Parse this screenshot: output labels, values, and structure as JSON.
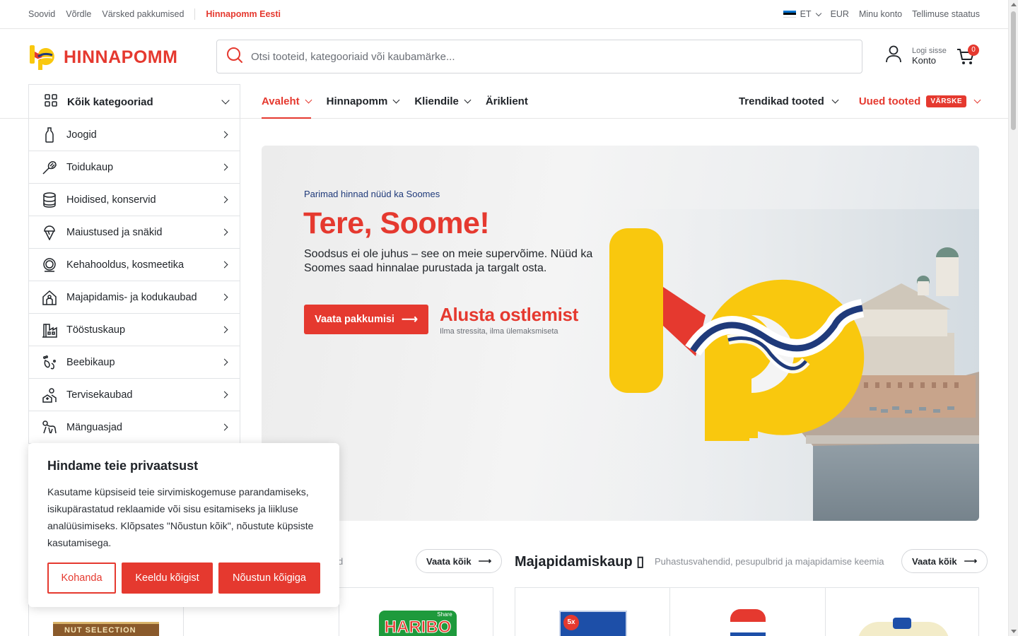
{
  "topbar": {
    "links": [
      "Soovid",
      "Võrdle",
      "Värsked pakkumised"
    ],
    "brand_link": "Hinnapomm Eesti",
    "language": "ET",
    "currency": "EUR",
    "my_account": "Minu konto",
    "order_status": "Tellimuse staatus"
  },
  "header": {
    "logo_text": "HINNAPOMM",
    "search_placeholder": "Otsi tooteid, kategooriaid või kaubamärke...",
    "login_label": "Logi sisse",
    "account_label": "Konto",
    "cart_count": "0"
  },
  "nav": {
    "all_categories": "Kõik kategooriad",
    "main": [
      {
        "label": "Avaleht",
        "active": true,
        "dropdown": true
      },
      {
        "label": "Hinnapomm",
        "dropdown": true
      },
      {
        "label": "Kliendile",
        "dropdown": true
      },
      {
        "label": "Äriklient",
        "dropdown": false
      }
    ],
    "trending": "Trendikad tooted",
    "new_products": "Uued tooted",
    "new_tag": "VÄRSKE"
  },
  "categories": [
    {
      "label": "Joogid",
      "icon": "bottle-icon"
    },
    {
      "label": "Toidukaup",
      "icon": "whisk-icon"
    },
    {
      "label": "Hoidised, konservid",
      "icon": "can-icon"
    },
    {
      "label": "Maiustused ja snäkid",
      "icon": "ice-cream-icon"
    },
    {
      "label": "Kehahooldus, kosmeetika",
      "icon": "mirror-icon"
    },
    {
      "label": "Majapidamis- ja kodukaubad",
      "icon": "house-icon"
    },
    {
      "label": "Tööstuskaup",
      "icon": "factory-icon"
    },
    {
      "label": "Beebikaup",
      "icon": "baby-feet-icon"
    },
    {
      "label": "Tervisekaubad",
      "icon": "health-icon"
    },
    {
      "label": "Mänguasjad",
      "icon": "toy-icon"
    }
  ],
  "hero": {
    "kicker": "Parimad hinnad nüüd ka Soomes",
    "title": "Tere, Soome!",
    "description": "Soodsus ei ole juhus – see on meie supervõime. Nüüd ka Soomes saad hinnalae purustada ja targalt osta.",
    "cta": "Vaata pakkumisi",
    "slogan": "Alusta ostlemist",
    "slogan_sub": "Ilma stressita, ilma ülemaksmiseta"
  },
  "sections": {
    "left_faded": "d",
    "left_view_all": "Vaata kõik",
    "right_title": "Majapidamiskaup",
    "right_title_glyph": "▯",
    "right_subtitle": "Puhastusvahendid, pesupulbrid ja majapidamise keemia",
    "right_view_all": "Vaata kõik"
  },
  "products": {
    "nut_label": "NUT SELECTION",
    "haribo_label": "HARIBO",
    "haribo_small": "Share",
    "detergent_label": "5x"
  },
  "cookie": {
    "title": "Hindame teie privaatsust",
    "text": "Kasutame küpsiseid teie sirvimiskogemuse parandamiseks, isikupärastatud reklaamide või sisu esitamiseks ja liikluse analüüsimiseks. Klõpsates \"Nõustun kõik\", nõustute küpsiste kasutamisega.",
    "customize": "Kohanda",
    "reject": "Keeldu kõigist",
    "accept": "Nõustun kõigiga"
  },
  "colors": {
    "brand_red": "#e5392f",
    "brand_yellow": "#f9c80e",
    "navy": "#1f3a7a"
  }
}
